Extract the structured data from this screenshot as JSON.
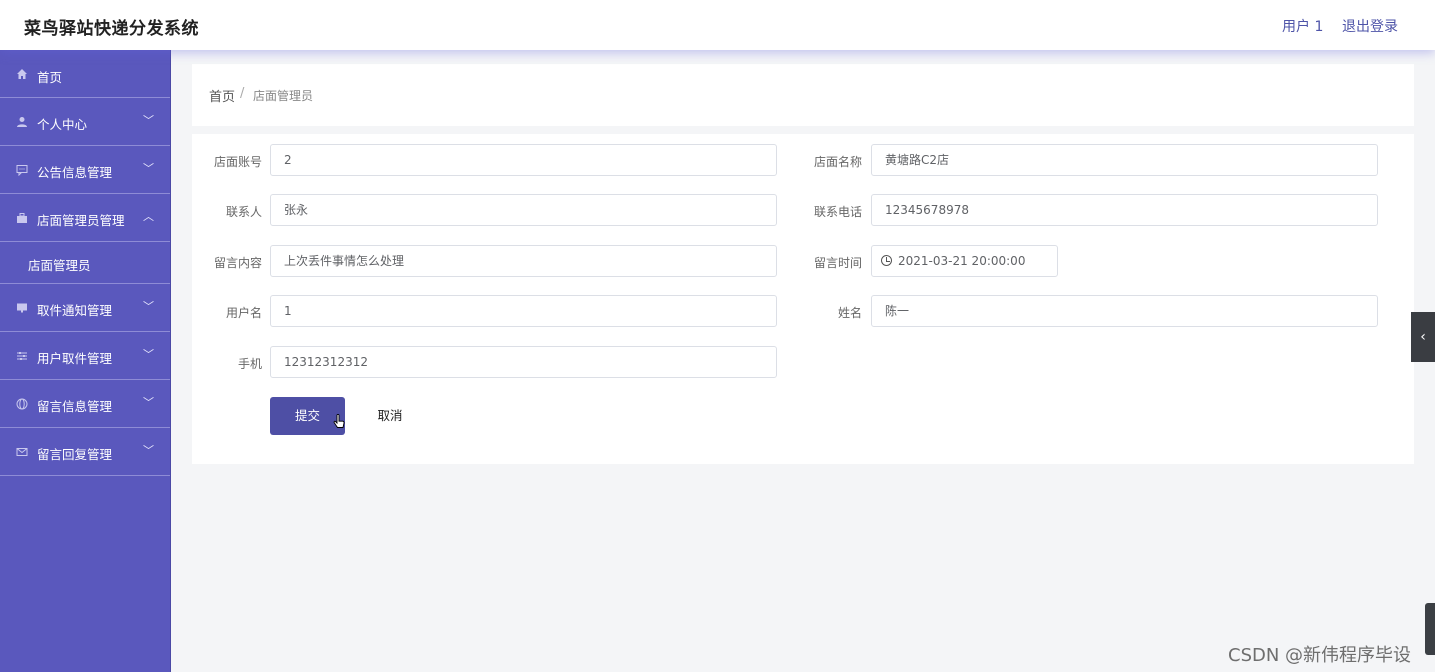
{
  "header": {
    "title": "菜鸟驿站快递分发系统",
    "user_label": "用户 1",
    "logout_label": "退出登录"
  },
  "sidebar": {
    "items": [
      {
        "label": "首页",
        "icon": "home-icon"
      },
      {
        "label": "个人中心",
        "icon": "person-icon",
        "expanded": false
      },
      {
        "label": "公告信息管理",
        "icon": "chat-icon",
        "expanded": false
      },
      {
        "label": "店面管理员管理",
        "icon": "briefcase-icon",
        "expanded": true,
        "children": [
          {
            "label": "店面管理员"
          }
        ]
      },
      {
        "label": "取件通知管理",
        "icon": "monitor-icon",
        "expanded": false
      },
      {
        "label": "用户取件管理",
        "icon": "sliders-icon",
        "expanded": false
      },
      {
        "label": "留言信息管理",
        "icon": "globe-icon",
        "expanded": false
      },
      {
        "label": "留言回复管理",
        "icon": "mail-icon",
        "expanded": false
      }
    ]
  },
  "breadcrumb": {
    "home": "首页",
    "separator": "/",
    "current": "店面管理员"
  },
  "form": {
    "fields": {
      "store_account": {
        "label": "店面账号",
        "value": "2"
      },
      "store_name": {
        "label": "店面名称",
        "value": "黄塘路C2店"
      },
      "contact": {
        "label": "联系人",
        "value": "张永"
      },
      "contact_phone": {
        "label": "联系电话",
        "value": "12345678978"
      },
      "message": {
        "label": "留言内容",
        "value": "上次丢件事情怎么处理"
      },
      "message_time": {
        "label": "留言时间",
        "value": "2021-03-21 20:00:00"
      },
      "username": {
        "label": "用户名",
        "value": "1"
      },
      "name": {
        "label": "姓名",
        "value": "陈一"
      },
      "mobile": {
        "label": "手机",
        "value": "12312312312"
      }
    },
    "submit_label": "提交",
    "cancel_label": "取消"
  },
  "watermark": "CSDN @新伟程序毕设",
  "colors": {
    "sidebar_bg": "#5a58bd",
    "primary_button": "#4e4fa5",
    "header_link": "#4e54a8"
  }
}
